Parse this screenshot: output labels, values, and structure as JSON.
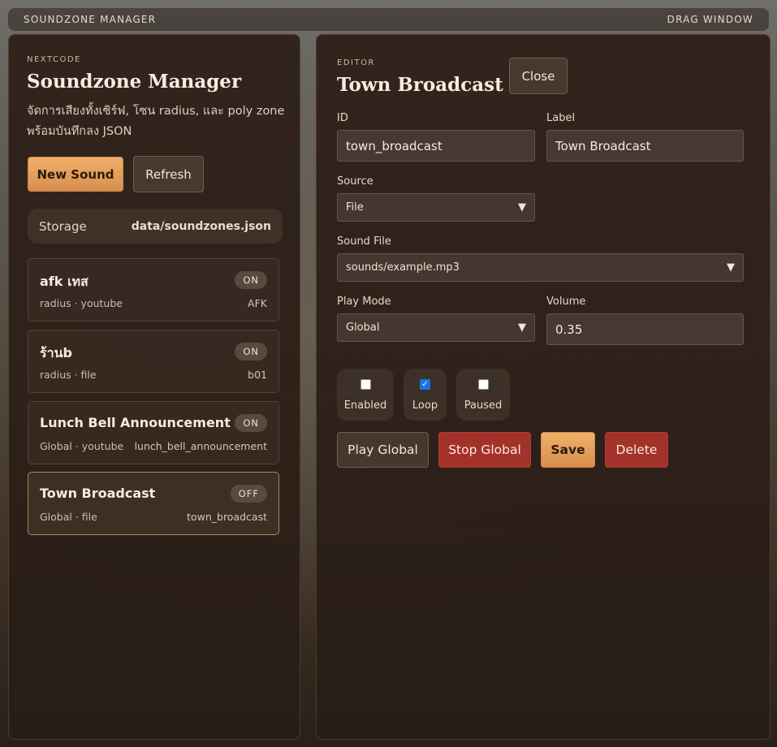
{
  "titlebar": {
    "title": "SOUNDZONE MANAGER",
    "drag": "DRAG WINDOW"
  },
  "sidebar": {
    "eyebrow": "NEXTCODE",
    "title": "Soundzone Manager",
    "description": "จัดการเสียงทั้งเซิร์ฟ, โซน radius, และ poly zone พร้อมบันทึกลง JSON",
    "new_label": "New Sound",
    "refresh_label": "Refresh",
    "storage": {
      "label": "Storage",
      "value": "data/soundzones.json"
    },
    "sounds": [
      {
        "name": "afk เทส",
        "meta": "radius · youtube",
        "id": "AFK",
        "status": "ON",
        "active": false
      },
      {
        "name": "ร้านb",
        "meta": "radius · file",
        "id": "b01",
        "status": "ON",
        "active": false
      },
      {
        "name": "Lunch Bell Announcement",
        "meta": "Global · youtube",
        "id": "lunch_bell_announcement",
        "status": "ON",
        "active": false
      },
      {
        "name": "Town Broadcast",
        "meta": "Global · file",
        "id": "town_broadcast",
        "status": "OFF",
        "active": true
      }
    ]
  },
  "editor": {
    "eyebrow": "EDITOR",
    "title": "Town Broadcast",
    "close_label": "Close",
    "fields": {
      "id": {
        "label": "ID",
        "value": "town_broadcast"
      },
      "label": {
        "label": "Label",
        "value": "Town Broadcast"
      },
      "source": {
        "label": "Source",
        "value": "File"
      },
      "sound_file": {
        "label": "Sound File",
        "value": "sounds/example.mp3"
      },
      "play_mode": {
        "label": "Play Mode",
        "value": "Global"
      },
      "volume": {
        "label": "Volume",
        "value": "0.35"
      }
    },
    "toggles": [
      {
        "label": "Enabled",
        "checked": false
      },
      {
        "label": "Loop",
        "checked": true
      },
      {
        "label": "Paused",
        "checked": false
      }
    ],
    "actions": {
      "play_global": "Play Global",
      "stop_global": "Stop Global",
      "save": "Save",
      "delete": "Delete"
    }
  }
}
